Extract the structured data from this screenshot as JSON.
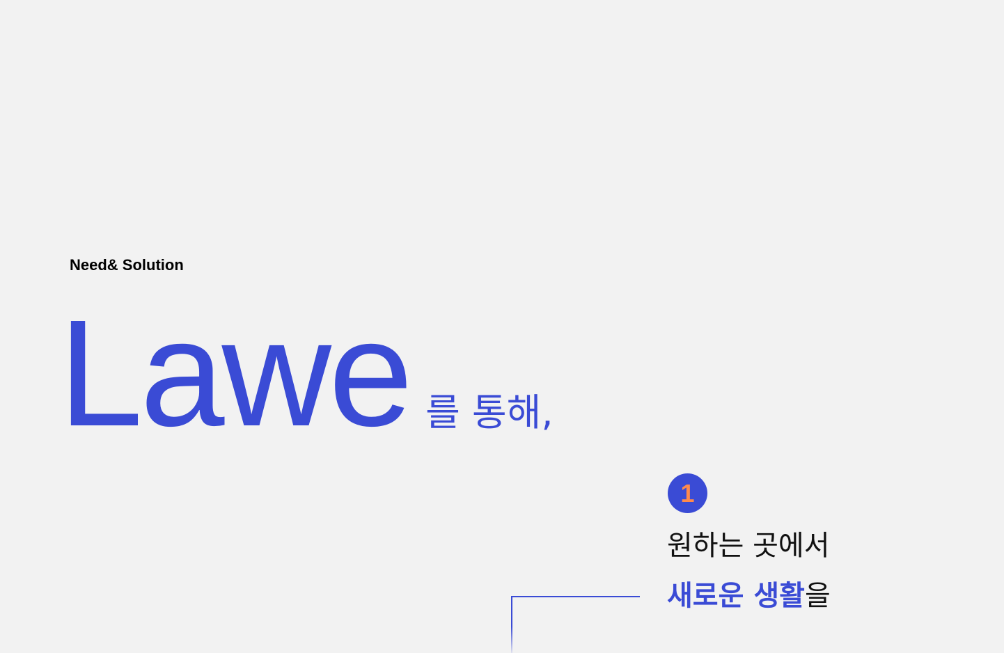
{
  "section": {
    "eyebrow": "Need& Solution"
  },
  "headline": {
    "brand": "Lawe",
    "suffix": "를 통해,"
  },
  "step": {
    "number": "1",
    "line1": "원하는 곳에서",
    "line2_highlight": "새로운 생활",
    "line2_rest": "을"
  },
  "colors": {
    "background": "#f2f2f2",
    "accent": "#3a4bd5",
    "badge_number": "#ff8a4c",
    "text": "#111111"
  }
}
